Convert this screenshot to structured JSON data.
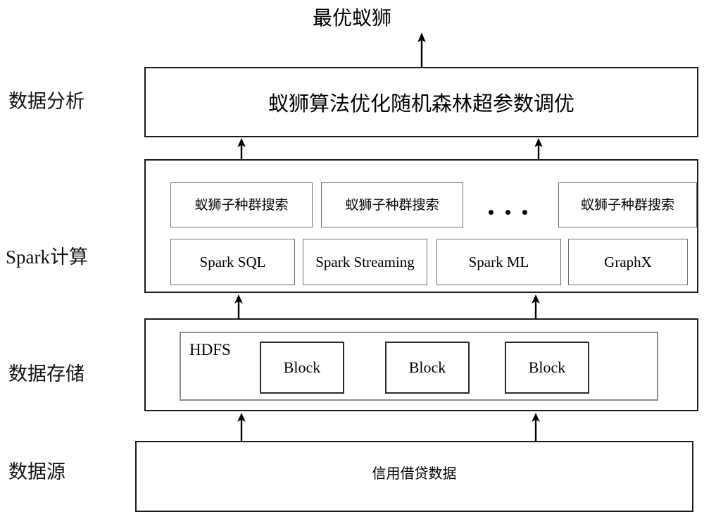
{
  "diagram": {
    "title_top": "最优蚁狮",
    "stages": [
      {
        "key": "analysis",
        "label": "数据分析"
      },
      {
        "key": "spark",
        "label": "Spark计算"
      },
      {
        "key": "storage",
        "label": "数据存储"
      },
      {
        "key": "source",
        "label": "数据源"
      }
    ],
    "analysis_layer": {
      "box_label": "蚁狮算法优化随机森林超参数调优"
    },
    "spark_layer": {
      "subpopulations": [
        {
          "label": "蚁狮子种群搜索"
        },
        {
          "label": "蚁狮子种群搜索"
        },
        {
          "label": "蚁狮子种群搜索"
        }
      ],
      "ellipsis": "· · ·",
      "components": [
        {
          "label": "Spark SQL"
        },
        {
          "label": "Spark Streaming"
        },
        {
          "label": "Spark ML"
        },
        {
          "label": "GraphX"
        }
      ]
    },
    "storage_layer": {
      "system_label": "HDFS",
      "blocks": [
        {
          "label": "Block"
        },
        {
          "label": "Block"
        },
        {
          "label": "Block"
        }
      ]
    },
    "source_layer": {
      "box_label": "信用借贷数据"
    },
    "colors": {
      "outline": "#1a1a1a",
      "inner_outline": "#6e6e6e",
      "block_outline": "#2a2a2a",
      "hdfs_outline": "#8c8c8c",
      "background": "#ffffff",
      "text": "#000000"
    }
  }
}
